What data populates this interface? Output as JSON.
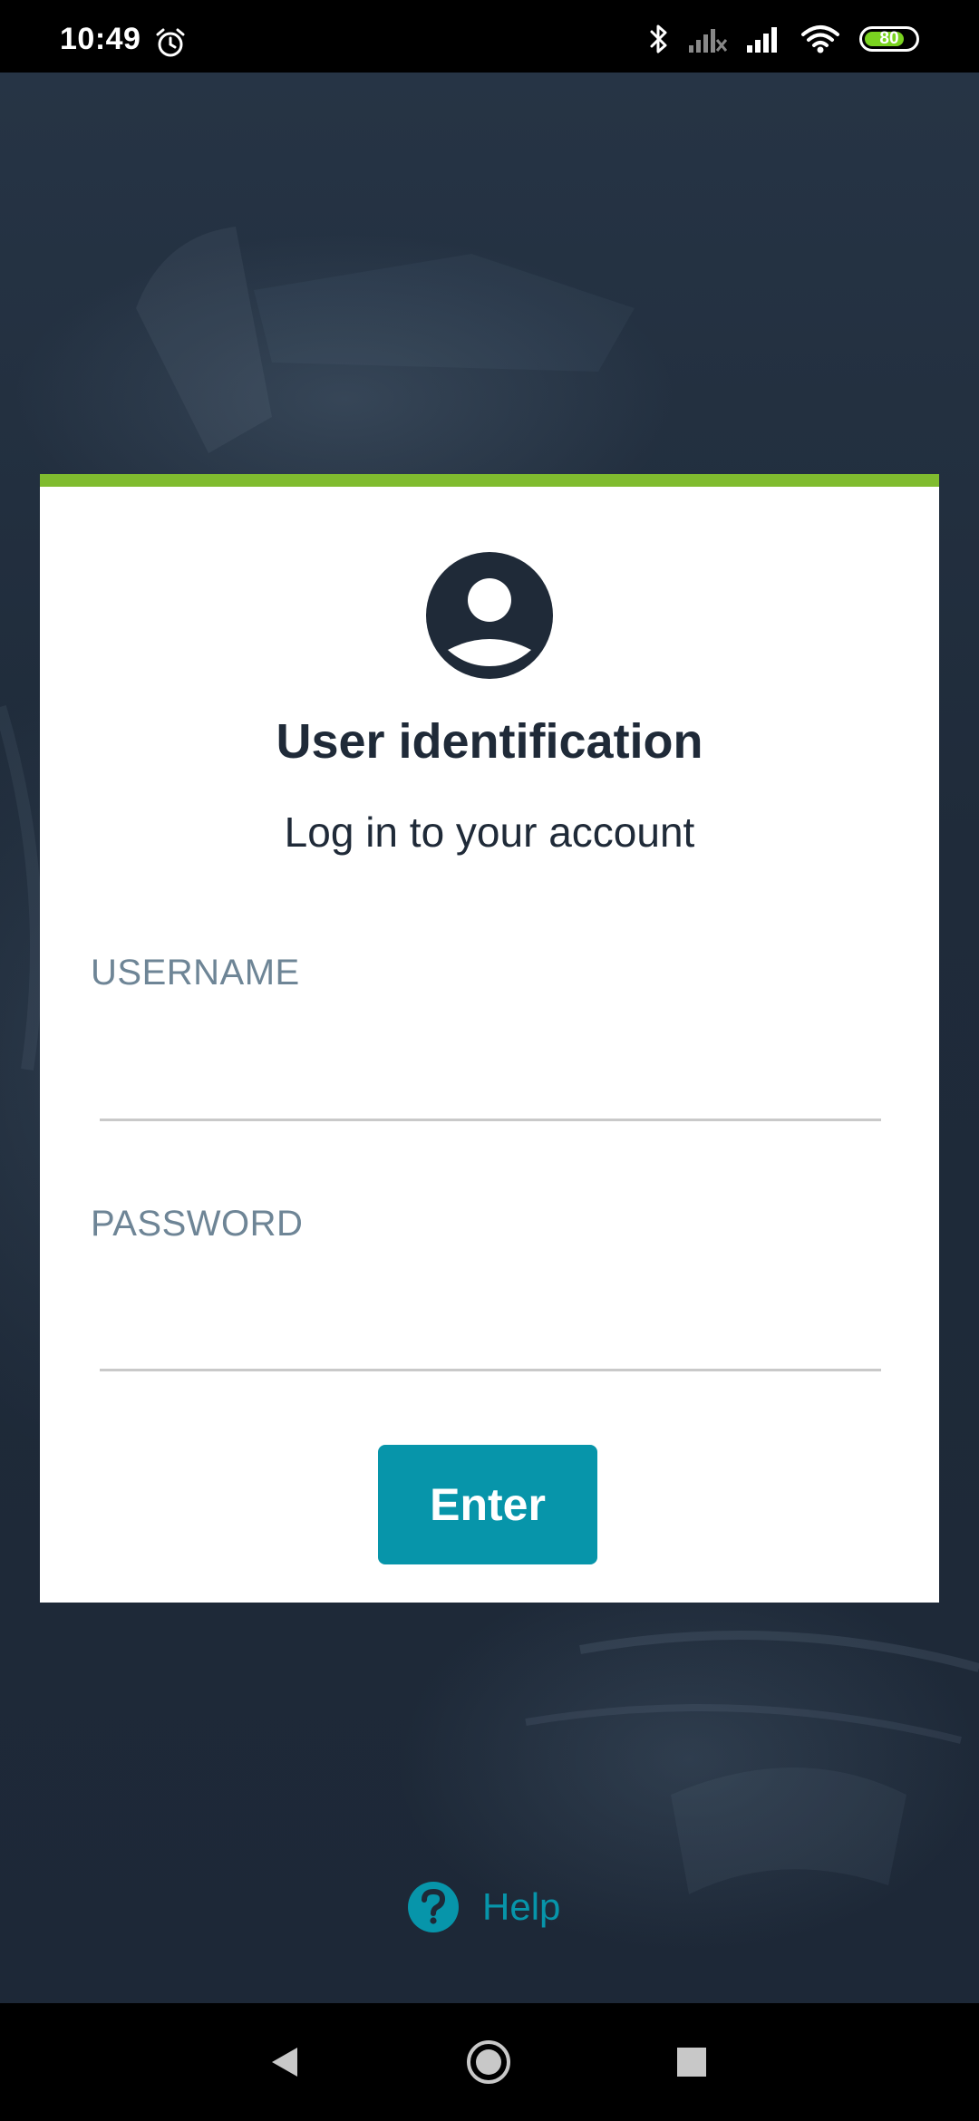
{
  "status_bar": {
    "time": "10:49",
    "battery_level": "80",
    "battery_fraction": 0.8,
    "icons": [
      "alarm-icon",
      "bluetooth-icon",
      "signal-no-service-icon",
      "signal-icon",
      "wifi-icon",
      "battery-icon"
    ]
  },
  "login_card": {
    "accent_color": "#80bc2f",
    "avatar_icon": "account-circle-icon",
    "title": "User identification",
    "subtitle": "Log in to your account",
    "username": {
      "label": "USERNAME",
      "value": "",
      "placeholder": ""
    },
    "password": {
      "label": "PASSWORD",
      "value": "",
      "placeholder": ""
    },
    "enter_button": "Enter",
    "button_color": "#0795aa"
  },
  "help": {
    "label": "Help",
    "icon": "help-circle-icon"
  },
  "nav_bar": {
    "buttons": [
      "back-icon",
      "home-icon",
      "recents-icon"
    ]
  }
}
